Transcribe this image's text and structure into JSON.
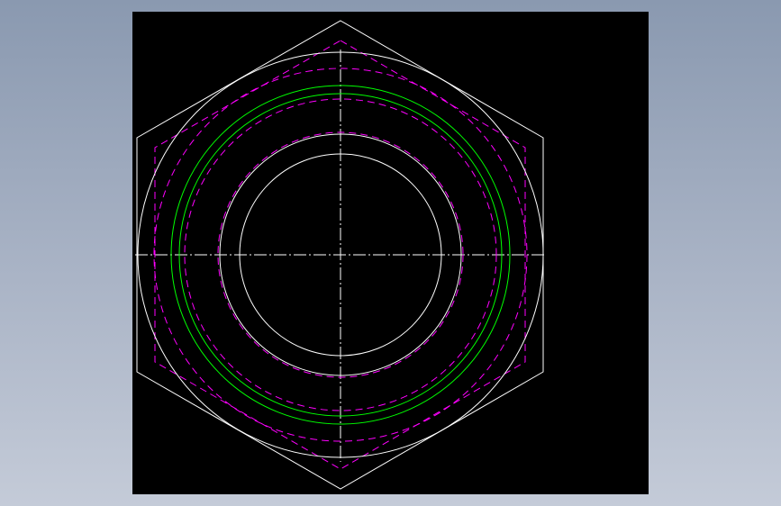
{
  "drawing": {
    "view": "top view",
    "part": "hex nut",
    "background_color": "#000000",
    "window_gradient": [
      "#8a99b0",
      "#c4cbd8"
    ],
    "colors": {
      "outline": "#ffffff",
      "hidden": "#ff00ff",
      "thread": "#00ff00",
      "centerline": "#ffffff"
    },
    "line_types": {
      "outline": "continuous",
      "hidden": "dashed",
      "thread": "continuous",
      "centerline": "dash-dot"
    }
  }
}
